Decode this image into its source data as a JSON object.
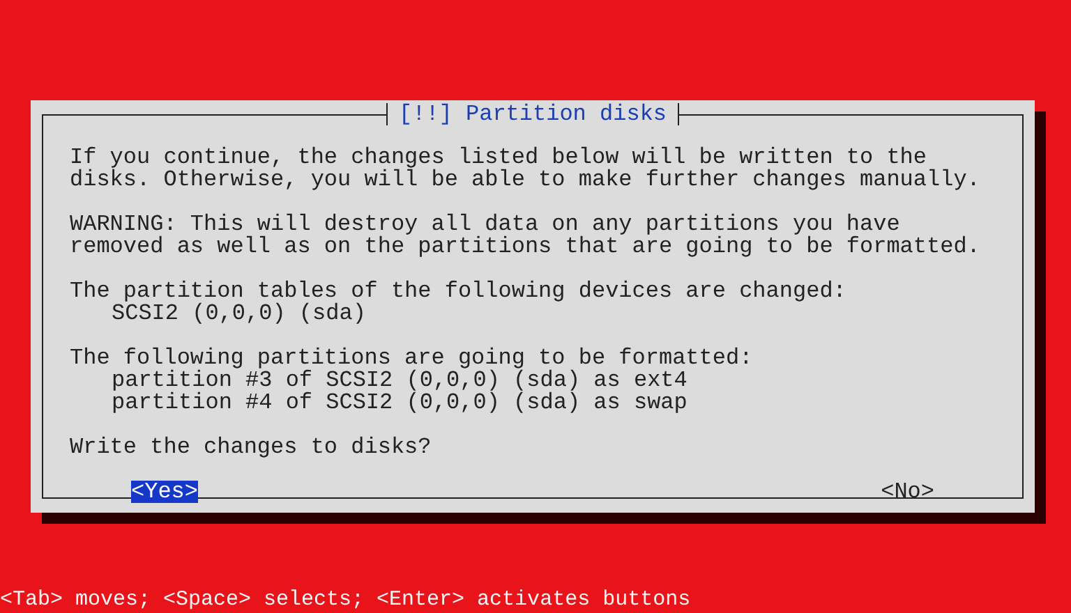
{
  "dialog": {
    "title": "[!!] Partition disks",
    "blocks": [
      {
        "kind": "text",
        "text": "If you continue, the changes listed below will be written to the\ndisks. Otherwise, you will be able to make further changes manually."
      },
      {
        "kind": "text",
        "text": "WARNING: This will destroy all data on any partitions you have\nremoved as well as on the partitions that are going to be formatted."
      },
      {
        "kind": "list",
        "heading": "The partition tables of the following devices are changed:",
        "items": [
          "SCSI2 (0,0,0) (sda)"
        ]
      },
      {
        "kind": "list",
        "heading": "The following partitions are going to be formatted:",
        "items": [
          "partition #3 of SCSI2 (0,0,0) (sda) as ext4",
          "partition #4 of SCSI2 (0,0,0) (sda) as swap"
        ]
      },
      {
        "kind": "text",
        "text": "Write the changes to disks?"
      }
    ],
    "buttons": [
      {
        "label": "<Yes>",
        "selected": true
      },
      {
        "label": "<No>",
        "selected": false
      }
    ]
  },
  "help_line": "<Tab> moves; <Space> selects; <Enter> activates buttons"
}
